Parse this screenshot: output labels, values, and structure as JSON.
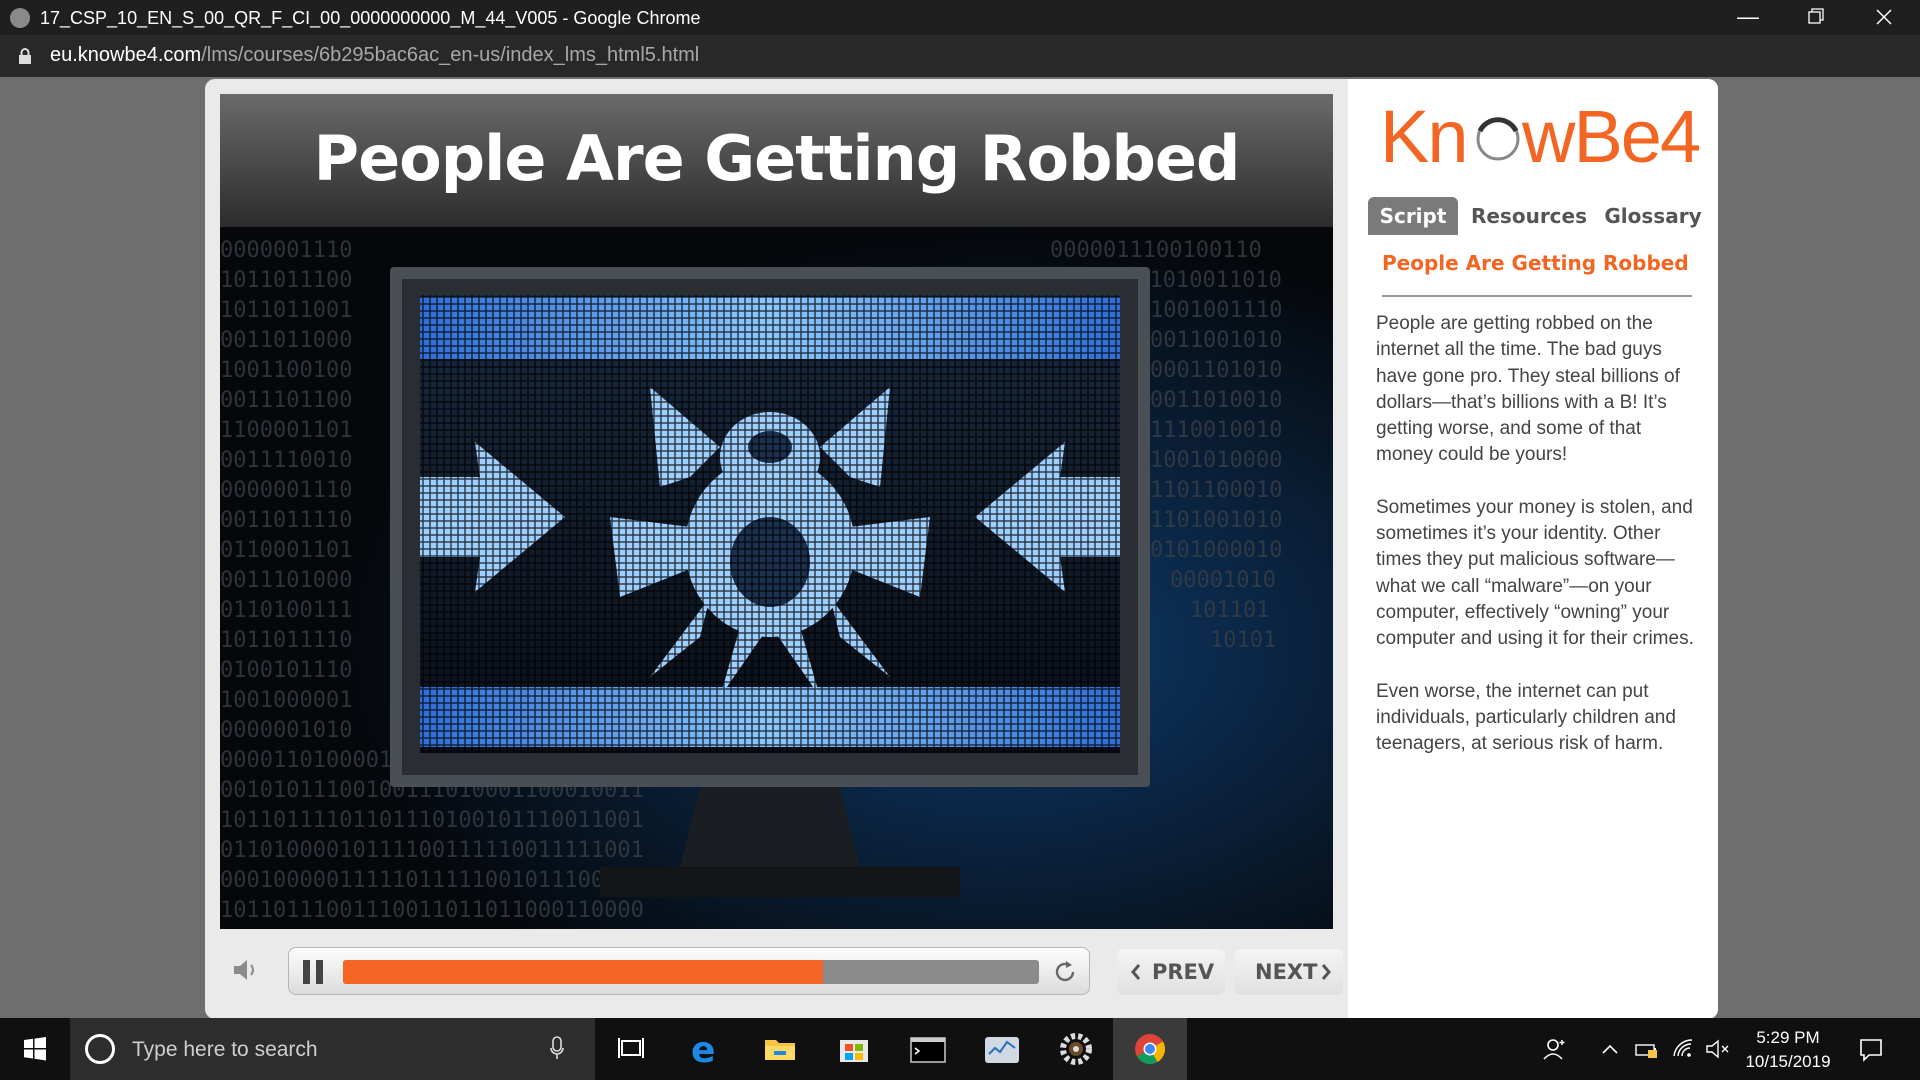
{
  "browser": {
    "window_title": "17_CSP_10_EN_S_00_QR_F_CI_00_0000000000_M_44_V005 - Google Chrome",
    "url_host": "eu.knowbe4.com",
    "url_path": "/lms/courses/6b295bac6ac_en-us/index_lms_html5.html"
  },
  "slide": {
    "title": "People Are Getting Robbed",
    "image": "malware-spider-monitor-icon"
  },
  "controls": {
    "prev_label": "PREV",
    "next_label": "NEXT",
    "progress_fraction": 0.69
  },
  "sidebar": {
    "logo_text": "KnowBe4",
    "tabs": [
      {
        "label": "Script",
        "active": true
      },
      {
        "label": "Resources",
        "active": false
      },
      {
        "label": "Glossary",
        "active": false
      }
    ],
    "script_heading": "People Are Getting Robbed",
    "script_paragraphs": [
      "People are getting robbed on the internet all the time. The bad guys have gone pro. They steal billions of dollars—that’s billions with a B! It’s getting worse, and some of that money could be yours!",
      "Sometimes your money is stolen, and sometimes it’s your identity. Other times they put malicious software—what we call “malware”—on your computer, effectively “owning” your computer and using it for their crimes.",
      "Even worse, the internet can put individuals, particularly children and teenagers, at serious risk of harm."
    ]
  },
  "taskbar": {
    "search_placeholder": "Type here to search",
    "time": "5:29 PM",
    "date": "10/15/2019"
  },
  "colors": {
    "accent": "#f26522",
    "tab_active": "#7a7a7a",
    "chrome_dark": "#1f1f1f"
  }
}
